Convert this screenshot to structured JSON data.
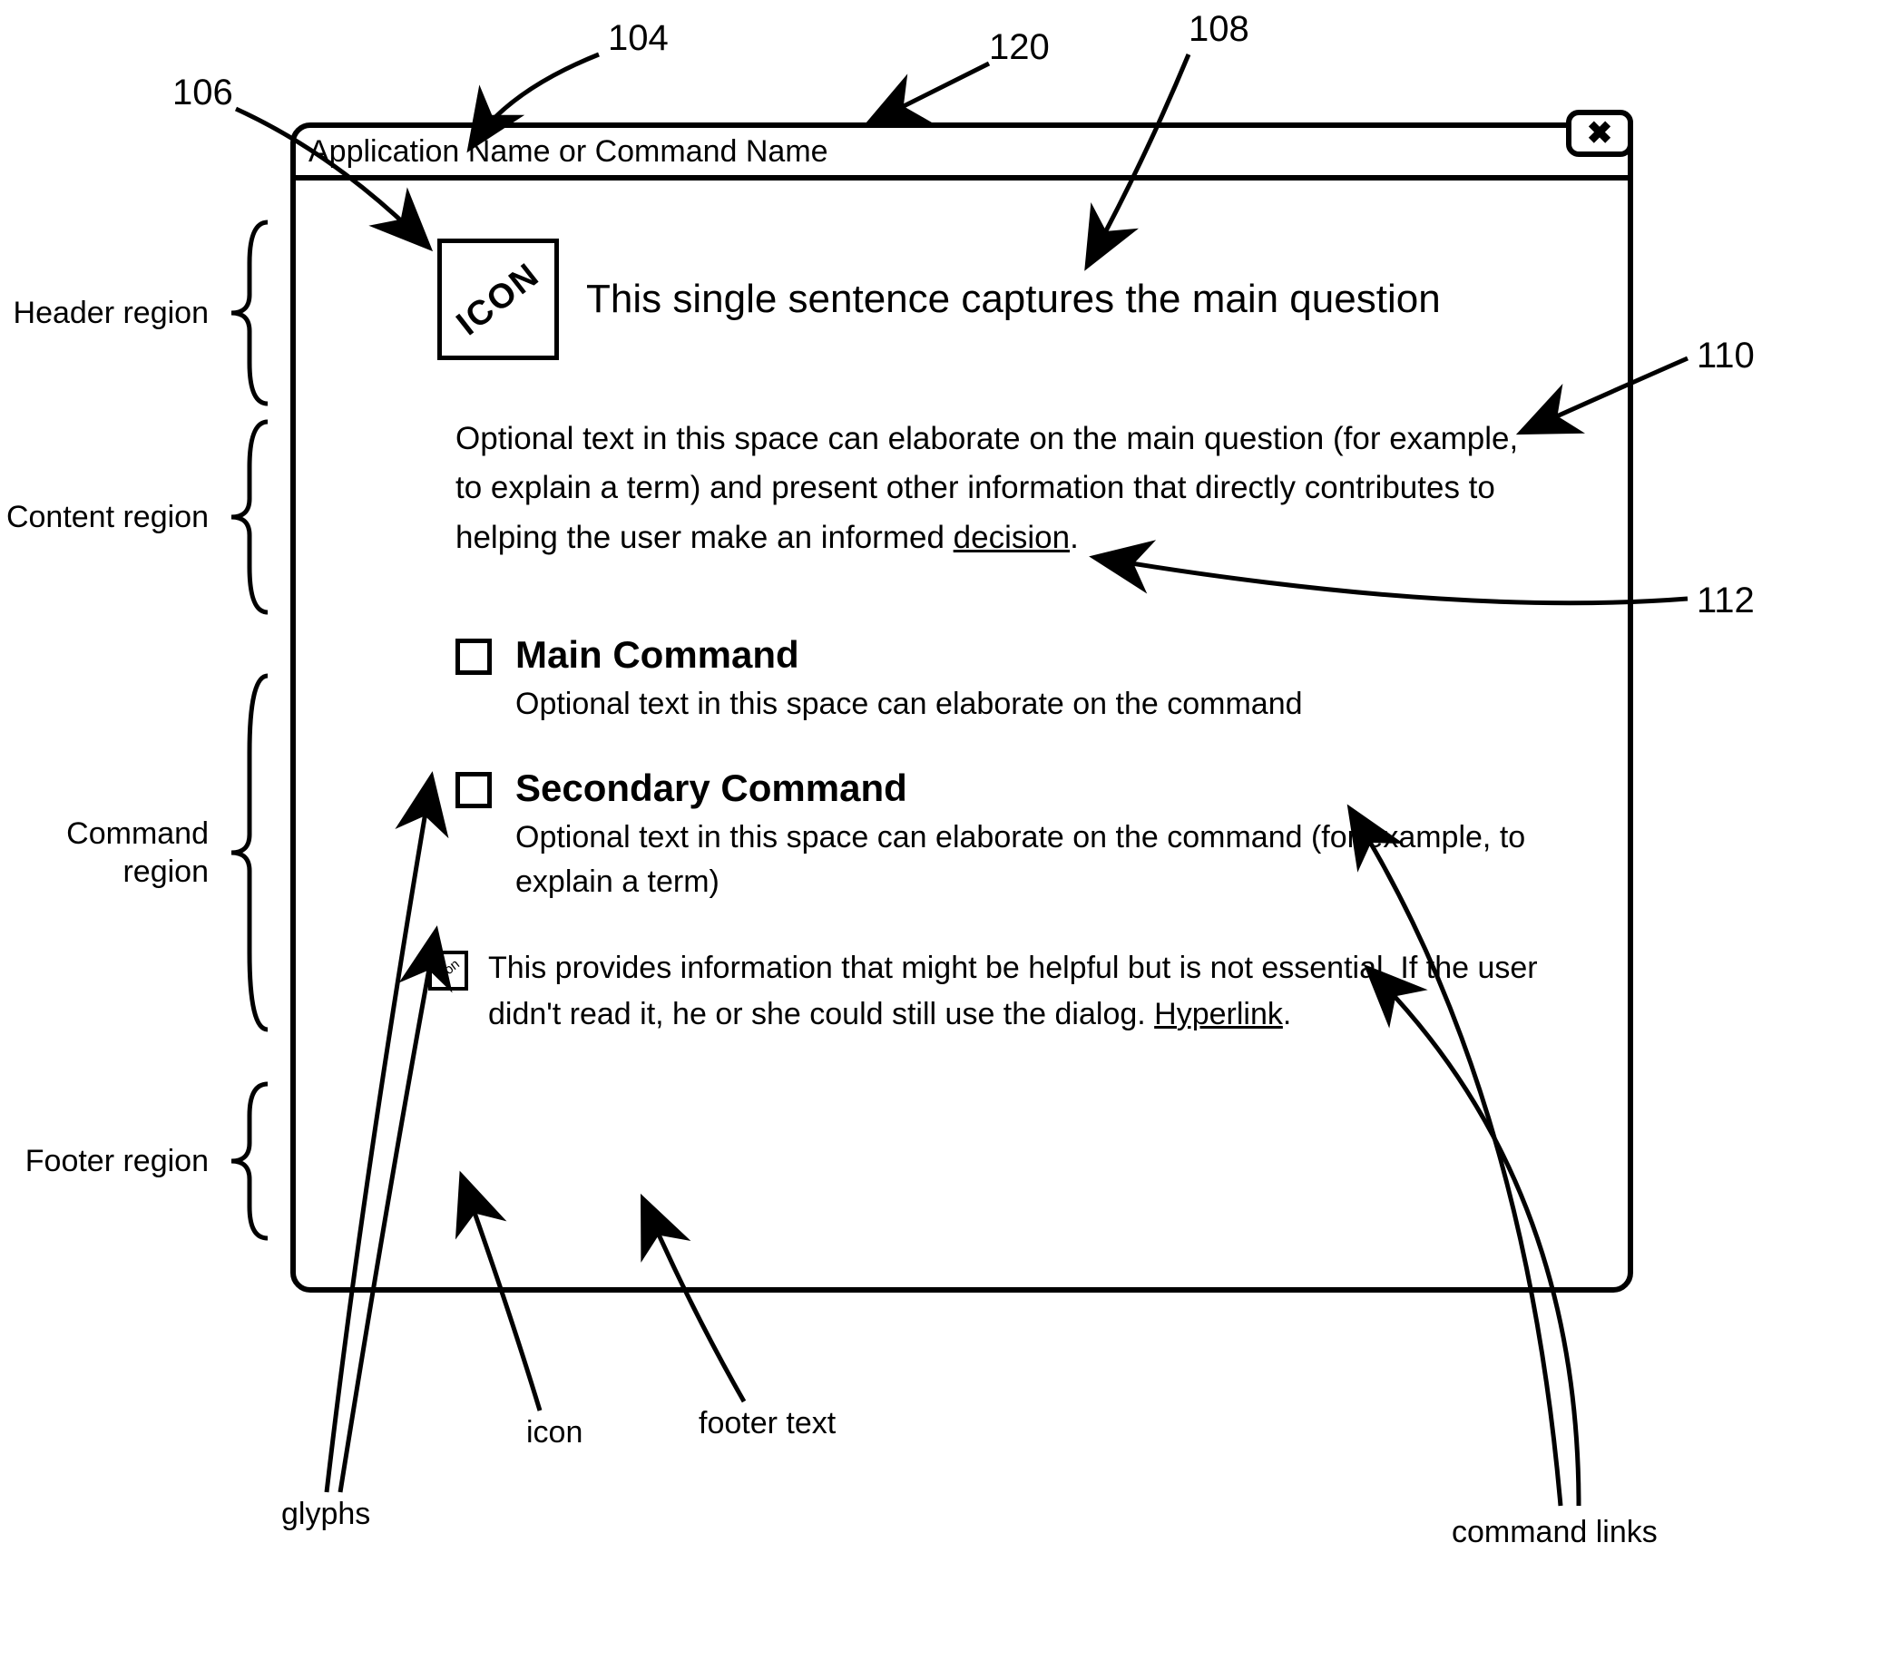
{
  "window": {
    "title": "Application Name or Command Name",
    "close_glyph": "✖"
  },
  "header": {
    "icon_label": "ICON",
    "main_question": "This single sentence captures the main question"
  },
  "content": {
    "text_pre": "Optional text in this space can elaborate on the main question (for example, to explain a term) and present other information that directly contributes to helping the user make an informed ",
    "link_word": "decision",
    "text_post": "."
  },
  "commands": [
    {
      "title": "Main Command",
      "sub": "Optional text in this space can elaborate on the command"
    },
    {
      "title": "Secondary Command",
      "sub": "Optional text in this space can elaborate on the command (for example, to explain a term)"
    }
  ],
  "footer": {
    "icon_label": "icon",
    "text_pre": "This provides information that might be helpful but is not essential.  If the user didn't read it, he or she could still use the dialog.  ",
    "link_word": "Hyperlink",
    "text_post": "."
  },
  "region_labels": {
    "header": "Header region",
    "content": "Content region",
    "command": "Command\nregion",
    "footer": "Footer region"
  },
  "callouts": {
    "glyphs": "glyphs",
    "icon": "icon",
    "footer_text": "footer text",
    "command_links": "command links"
  },
  "refs": {
    "r104": "104",
    "r106": "106",
    "r108": "108",
    "r110": "110",
    "r112": "112",
    "r120": "120"
  }
}
